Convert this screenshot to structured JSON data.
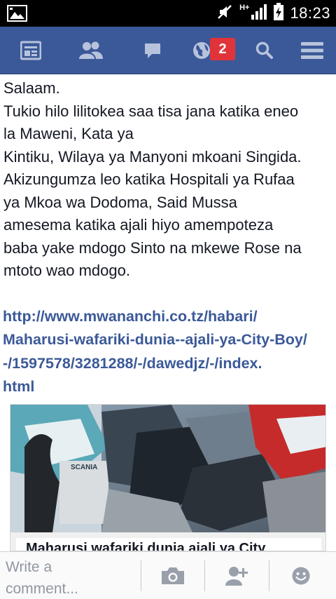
{
  "status_bar": {
    "network": "H+",
    "time": "18:23"
  },
  "nav": {
    "items": [
      {
        "name": "news-feed-icon"
      },
      {
        "name": "friend-requests-icon"
      },
      {
        "name": "messages-icon"
      },
      {
        "name": "notifications-globe-icon"
      },
      {
        "name": "search-icon"
      },
      {
        "name": "menu-icon"
      }
    ],
    "notifications_badge": "2",
    "color": "#3b5998",
    "badge_color": "#e0343a"
  },
  "post": {
    "lines": [
      "Salaam.",
      "Tukio hilo lilitokea saa tisa jana katika eneo",
      "la Maweni, Kata ya",
      "Kintiku, Wilaya ya Manyoni mkoani Singida.",
      "Akizungumza leo katika Hospitali ya Rufaa",
      "ya Mkoa wa Dodoma, Said Mussa",
      "amesema katika ajali hiyo amempoteza",
      "baba yake mdogo Sinto na mkewe Rose na",
      "mtoto wao mdogo."
    ],
    "link_lines": [
      "http://www.mwananchi.co.tz/habari/",
      "Maharusi-wafariki-dunia--ajali-ya-City-Boy/",
      "-/1597578/3281288/-/dawedjz/-/index.",
      "html"
    ],
    "preview": {
      "image_text": "SCANIA",
      "caption": "Maharusi wafariki dunia ajali ya City"
    }
  },
  "comment_bar": {
    "placeholder_line1": "Write a",
    "placeholder_line2": "comment..."
  }
}
